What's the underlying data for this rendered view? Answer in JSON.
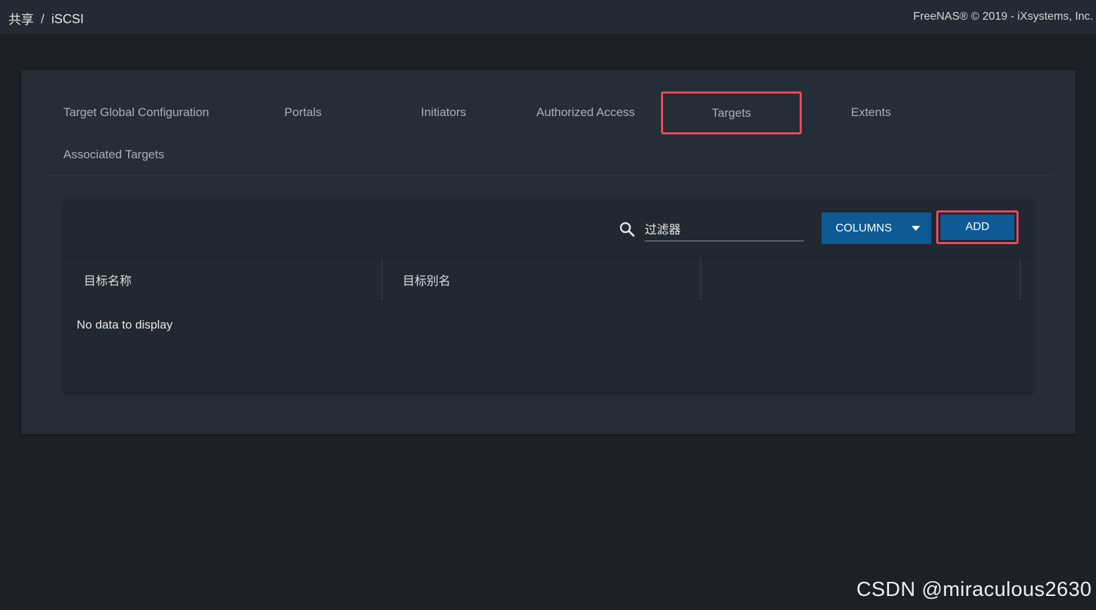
{
  "breadcrumb": {
    "parent": "共享",
    "separator": "/",
    "current": "iSCSI"
  },
  "copyright": "FreeNAS® © 2019 - iXsystems, Inc.",
  "tabs": [
    {
      "label": "Target Global Configuration"
    },
    {
      "label": "Portals"
    },
    {
      "label": "Initiators"
    },
    {
      "label": "Authorized Access"
    },
    {
      "label": "Targets",
      "active": true
    },
    {
      "label": "Extents"
    },
    {
      "label": "Associated Targets"
    }
  ],
  "toolbar": {
    "search_icon": "search-icon",
    "filter_placeholder": "过滤器",
    "columns_label": "COLUMNS",
    "add_label": "ADD"
  },
  "table": {
    "columns": [
      "目标名称",
      "目标别名",
      ""
    ],
    "empty_message": "No data to display"
  },
  "watermark": "CSDN @miraculous2630",
  "colors": {
    "background": "#1b2029",
    "card": "#252d37",
    "button": "#0d5a94",
    "highlight": "#f0475e"
  }
}
